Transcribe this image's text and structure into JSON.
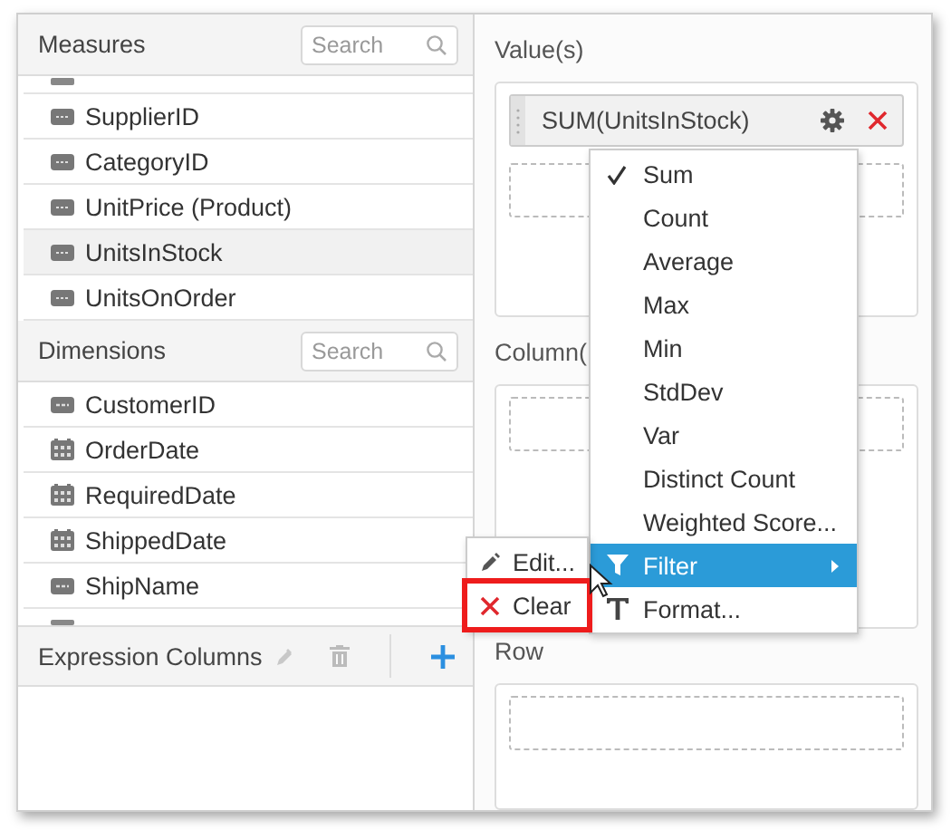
{
  "measures": {
    "title": "Measures",
    "search": {
      "placeholder": "Search"
    },
    "items": [
      {
        "name": "SupplierID",
        "kind": "number",
        "selected": false
      },
      {
        "name": "CategoryID",
        "kind": "number",
        "selected": false
      },
      {
        "name": "UnitPrice (Product)",
        "kind": "number",
        "selected": false
      },
      {
        "name": "UnitsInStock",
        "kind": "number",
        "selected": true
      },
      {
        "name": "UnitsOnOrder",
        "kind": "number",
        "selected": false
      }
    ]
  },
  "dimensions": {
    "title": "Dimensions",
    "search": {
      "placeholder": "Search"
    },
    "items": [
      {
        "name": "CustomerID",
        "kind": "string",
        "selected": false
      },
      {
        "name": "OrderDate",
        "kind": "date",
        "selected": false
      },
      {
        "name": "RequiredDate",
        "kind": "date",
        "selected": false
      },
      {
        "name": "ShippedDate",
        "kind": "date",
        "selected": false
      },
      {
        "name": "ShipName",
        "kind": "string",
        "selected": false
      }
    ]
  },
  "expression_columns": {
    "title": "Expression Columns",
    "edit_disabled": true,
    "delete_disabled": true
  },
  "values": {
    "label": "Value(s)",
    "items": [
      {
        "text": "SUM(UnitsInStock)"
      }
    ]
  },
  "columns": {
    "label": "Column("
  },
  "rows": {
    "label": "Row"
  },
  "aggregate_menu": {
    "items": [
      {
        "label": "Sum",
        "kind": "check",
        "checked": true,
        "selected": false
      },
      {
        "label": "Count",
        "kind": "check",
        "checked": false,
        "selected": false
      },
      {
        "label": "Average",
        "kind": "check",
        "checked": false,
        "selected": false
      },
      {
        "label": "Max",
        "kind": "check",
        "checked": false,
        "selected": false
      },
      {
        "label": "Min",
        "kind": "check",
        "checked": false,
        "selected": false
      },
      {
        "label": "StdDev",
        "kind": "check",
        "checked": false,
        "selected": false
      },
      {
        "label": "Var",
        "kind": "check",
        "checked": false,
        "selected": false
      },
      {
        "label": "Distinct Count",
        "kind": "check",
        "checked": false,
        "selected": false
      },
      {
        "label": "Weighted Score...",
        "kind": "check",
        "checked": false,
        "selected": false
      },
      {
        "label": "Filter",
        "kind": "filter",
        "selected": true
      },
      {
        "label": "Format...",
        "kind": "format",
        "selected": false
      }
    ]
  },
  "filter_submenu": {
    "items": [
      {
        "label": "Edit...",
        "kind": "edit",
        "highlighted": false
      },
      {
        "label": "Clear",
        "kind": "clear",
        "highlighted": true
      }
    ]
  }
}
